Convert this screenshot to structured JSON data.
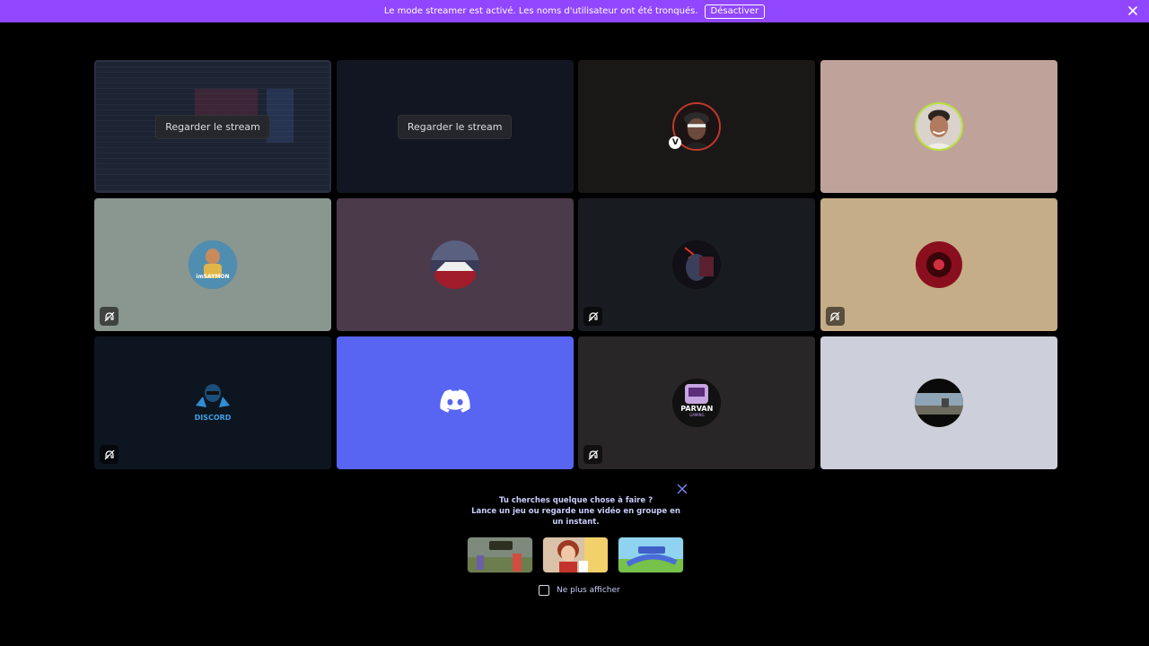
{
  "banner": {
    "message": "Le mode streamer est activé. Les noms d'utilisateur ont été tronqués.",
    "disable_label": "Désactiver",
    "background": "#9147ff"
  },
  "tiles": [
    {
      "kind": "stream",
      "button_label": "Regarder le stream",
      "bg": "#141a2a"
    },
    {
      "kind": "stream",
      "button_label": "Regarder le stream",
      "bg": "#121622"
    },
    {
      "kind": "avatar",
      "bg": "#1a1817",
      "avatar": "hooded-man-avatar",
      "muted": false
    },
    {
      "kind": "avatar",
      "bg": "#bfa39a",
      "avatar": "smiling-man-avatar",
      "muted": false
    },
    {
      "kind": "avatar",
      "bg": "#8a9690",
      "avatar": "gamer-logo-avatar",
      "avatar_text": "imSAYMON",
      "muted": true
    },
    {
      "kind": "avatar",
      "bg": "#4b3a4a",
      "avatar": "car-avatar",
      "muted": false
    },
    {
      "kind": "avatar",
      "bg": "#181b20",
      "avatar": "dark-character-avatar",
      "muted": true
    },
    {
      "kind": "avatar",
      "bg": "#c5ad87",
      "avatar": "red-emblem-avatar",
      "muted": true
    },
    {
      "kind": "avatar",
      "bg": "#0d1620",
      "avatar": "discord-character-avatar",
      "avatar_text": "DISCORD",
      "muted": true
    },
    {
      "kind": "avatar",
      "bg": "#5865f2",
      "avatar": "discord-logo-icon",
      "muted": false
    },
    {
      "kind": "avatar",
      "bg": "#292628",
      "avatar": "parvan-gaming-avatar",
      "avatar_text": "PARVAN",
      "avatar_subtext": "GAMING",
      "muted": true
    },
    {
      "kind": "avatar",
      "bg": "#cdd0da",
      "avatar": "landscape-avatar",
      "muted": false
    }
  ],
  "activity_panel": {
    "line1": "Tu cherches quelque chose à faire ?",
    "line2": "Lance un jeu ou regarde une vidéo en groupe en un instant.",
    "games": [
      {
        "name": "Strike game",
        "icon": "strike-game-thumbnail"
      },
      {
        "name": "Card game",
        "icon": "card-game-thumbnail"
      },
      {
        "name": "Track game",
        "icon": "track-game-thumbnail"
      }
    ],
    "checkbox_label": "Ne plus afficher",
    "checked": false
  },
  "colors": {
    "accent": "#5865f2",
    "text_muted": "#c9cdfb"
  }
}
